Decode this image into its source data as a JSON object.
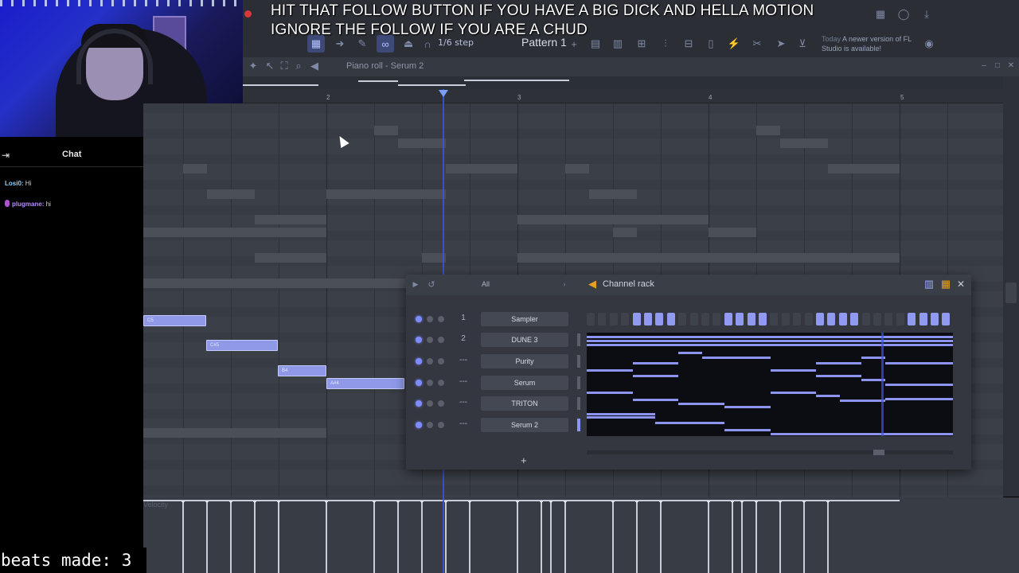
{
  "overlay": {
    "line1": "HIT THAT FOLLOW BUTTON IF YOU HAVE A BIG DICK AND HELLA MOTION",
    "line2": "IGNORE THE FOLLOW IF YOU ARE A CHUD"
  },
  "toolbar": {
    "step_label": "1/6 step",
    "pattern_label": "Pattern 1",
    "update_day": "Today",
    "update_text": "A newer version of FL Studio is available!"
  },
  "piano_roll": {
    "title": "Piano roll - Serum 2",
    "ruler": [
      "2",
      "3",
      "4",
      "5"
    ],
    "notes": [
      {
        "label": "C5"
      },
      {
        "label": "C#5"
      },
      {
        "label": "B4"
      },
      {
        "label": "A#4"
      }
    ],
    "velocity_label": "Velocity"
  },
  "chat": {
    "title": "Chat",
    "messages": [
      {
        "user": "Losi0:",
        "text": "Hi"
      },
      {
        "user": "plugmane:",
        "text": "hi"
      }
    ]
  },
  "beats_counter": "beats made: 3",
  "channel_rack": {
    "title": "Channel rack",
    "filter": "All",
    "channels": [
      {
        "num": "1",
        "name": "Sampler"
      },
      {
        "num": "2",
        "name": "DUNE 3"
      },
      {
        "num": "---",
        "name": "Purity"
      },
      {
        "num": "---",
        "name": "Serum"
      },
      {
        "num": "---",
        "name": "TRITON"
      },
      {
        "num": "---",
        "name": "Serum 2"
      }
    ],
    "add_label": "+"
  }
}
